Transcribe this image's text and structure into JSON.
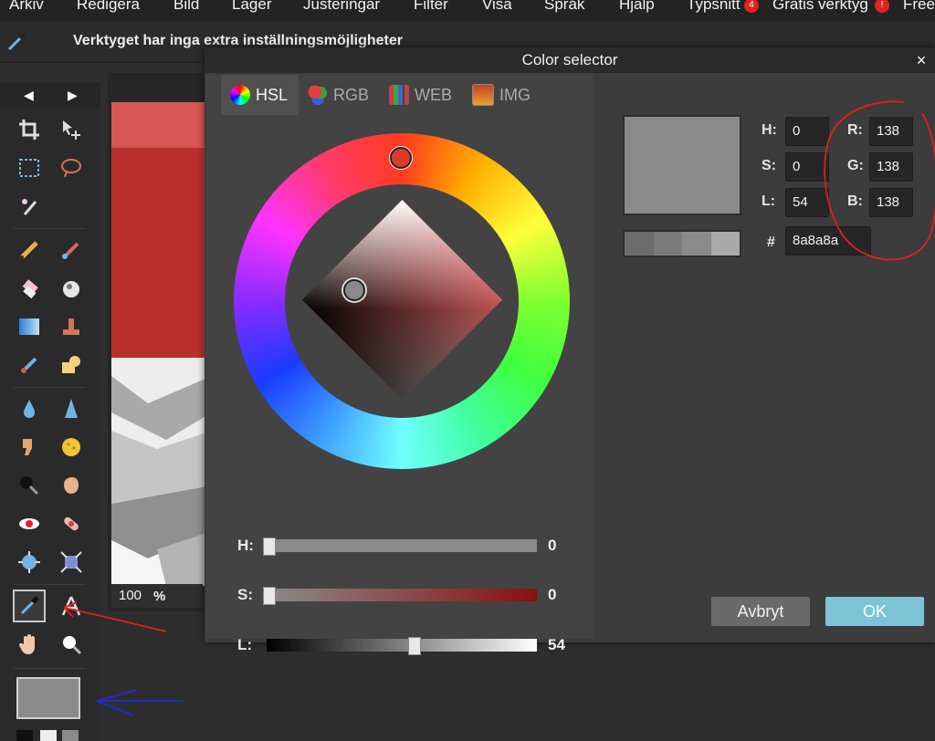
{
  "menu": {
    "items": [
      "Arkiv",
      "Redigera",
      "Bild",
      "Lager",
      "Justeringar",
      "Filter",
      "Visa",
      "Språk",
      "Hjälp",
      "Typsnitt",
      "Gratis verktyg",
      "Free"
    ],
    "typsnitt_badge": "4",
    "gratis_badge": "!"
  },
  "options_bar": {
    "tip": "Verktyget har inga extra inställningsmöjligheter"
  },
  "canvas": {
    "zoom_value": "100",
    "zoom_unit": "%"
  },
  "dialog": {
    "title": "Color selector",
    "close_label": "×",
    "tabs": [
      {
        "label": "HSL",
        "selected": true
      },
      {
        "label": "RGB",
        "selected": false
      },
      {
        "label": "WEB",
        "selected": false
      },
      {
        "label": "IMG",
        "selected": false
      }
    ],
    "sliders": [
      {
        "label": "H:",
        "value": "0"
      },
      {
        "label": "S:",
        "value": "0"
      },
      {
        "label": "L:",
        "value": "54"
      }
    ],
    "fields": {
      "h_label": "H:",
      "h_value": "0",
      "s_label": "S:",
      "s_value": "0",
      "l_label": "L:",
      "l_value": "54",
      "r_label": "R:",
      "r_value": "138",
      "g_label": "G:",
      "g_value": "138",
      "b_label": "B:",
      "b_value": "138",
      "hex_label": "#",
      "hex_value": "8a8a8a"
    },
    "preview_color": "#8a8a8a",
    "cancel_label": "Avbryt",
    "ok_label": "OK"
  },
  "colors": {
    "accent": "#7dc4d6",
    "annotation_red": "#e0201c",
    "annotation_blue": "#1a2bd8"
  }
}
